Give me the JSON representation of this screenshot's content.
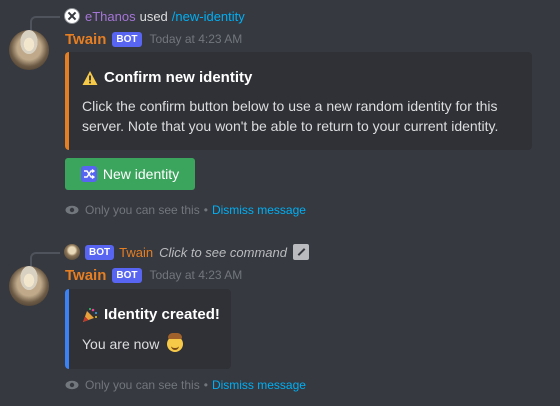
{
  "message1": {
    "reply": {
      "user": "eThanos",
      "used_text": "used",
      "command": "/new-identity"
    },
    "author": "Twain",
    "bot_tag": "BOT",
    "timestamp": "Today at 4:23 AM",
    "embed": {
      "title": "Confirm new identity",
      "description": "Click the confirm button below to use a new random identity for this server. Note that you won't be able to return to your current identity.",
      "accent_color": "#e67e22"
    },
    "button": {
      "label": "New identity",
      "color": "#3ba55d"
    },
    "ephemeral": {
      "note": "Only you can see this",
      "separator": "•",
      "dismiss": "Dismiss message"
    }
  },
  "message2": {
    "reply": {
      "bot_tag": "BOT",
      "user": "Twain",
      "command_hint": "Click to see command"
    },
    "author": "Twain",
    "bot_tag": "BOT",
    "timestamp": "Today at 4:23 AM",
    "embed": {
      "title": "Identity created!",
      "description": "You are now",
      "accent_color": "#3b82f6"
    },
    "ephemeral": {
      "note": "Only you can see this",
      "separator": "•",
      "dismiss": "Dismiss message"
    }
  },
  "colors": {
    "background": "#36393f",
    "embed_bg": "#2f3136",
    "bot_name": "#e67e22",
    "bot_tag": "#5865f2",
    "link": "#00aff4"
  }
}
